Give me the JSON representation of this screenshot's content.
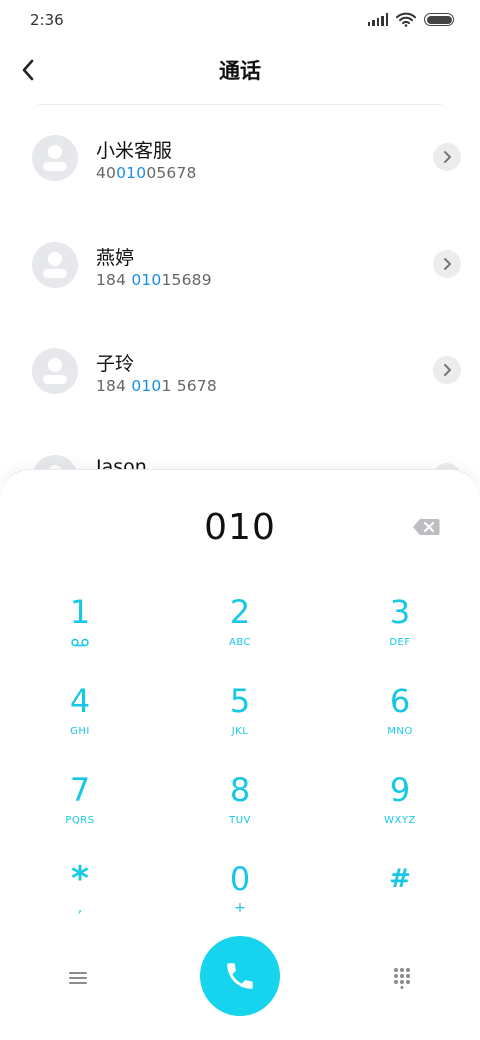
{
  "status_bar": {
    "time": "2:36"
  },
  "header": {
    "title": "通话"
  },
  "contacts": [
    {
      "name": "小米客服",
      "number_pre": "40",
      "number_match": "010",
      "number_post": "05678"
    },
    {
      "name": "燕婷",
      "number_pre": "184 ",
      "number_match": "010",
      "number_post": "15689"
    },
    {
      "name": "子玲",
      "number_pre": "184 ",
      "number_match": "010",
      "number_post": "1 5678"
    },
    {
      "name": "Jason",
      "number_pre": "",
      "number_match": "",
      "number_post": ""
    }
  ],
  "dialer": {
    "display": "010",
    "keys": [
      {
        "digit": "1",
        "letters": ""
      },
      {
        "digit": "2",
        "letters": "ABC"
      },
      {
        "digit": "3",
        "letters": "DEF"
      },
      {
        "digit": "4",
        "letters": "GHI"
      },
      {
        "digit": "5",
        "letters": "JKL"
      },
      {
        "digit": "6",
        "letters": "MNO"
      },
      {
        "digit": "7",
        "letters": "PQRS"
      },
      {
        "digit": "8",
        "letters": "TUV"
      },
      {
        "digit": "9",
        "letters": "WXYZ"
      },
      {
        "digit": "*",
        "letters": ","
      },
      {
        "digit": "0",
        "letters": "+"
      },
      {
        "digit": "#",
        "letters": ""
      }
    ]
  },
  "colors": {
    "accent": "#16c8e6",
    "call_button": "#17d4ee",
    "match_highlight": "#1a8fe3"
  },
  "icons": {
    "back": "chevron-left-icon",
    "detail": "chevron-right-icon",
    "backspace": "backspace-icon",
    "voicemail": "voicemail-icon",
    "menu": "menu-icon",
    "call": "phone-icon",
    "keypad": "dialpad-icon"
  }
}
